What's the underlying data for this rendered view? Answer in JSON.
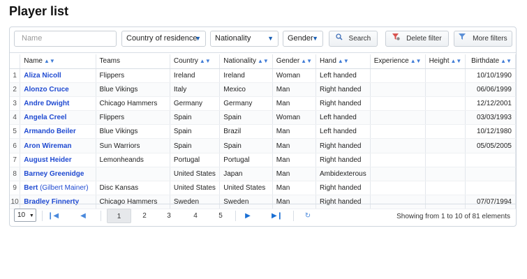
{
  "page_title": "Player list",
  "filters": {
    "name_placeholder": "Name",
    "country": "Country of residence",
    "nationality": "Nationality",
    "gender": "Gender",
    "search": "Search",
    "delete_filter": "Delete filter",
    "more_filters": "More filters"
  },
  "columns": [
    "Name",
    "Teams",
    "Country",
    "Nationality",
    "Gender",
    "Hand",
    "Experience",
    "Height",
    "Birthdate"
  ],
  "rows": [
    {
      "idx": "1",
      "name": "Aliza Nicoll",
      "alt": "",
      "teams": "Flippers",
      "country": "Ireland",
      "nationality": "Ireland",
      "gender": "Woman",
      "hand": "Left handed",
      "experience": "",
      "height": "",
      "birthdate": "10/10/1990"
    },
    {
      "idx": "2",
      "name": "Alonzo Cruce",
      "alt": "",
      "teams": "Blue Vikings",
      "country": "Italy",
      "nationality": "Mexico",
      "gender": "Man",
      "hand": "Right handed",
      "experience": "",
      "height": "",
      "birthdate": "06/06/1999"
    },
    {
      "idx": "3",
      "name": "Andre Dwight",
      "alt": "",
      "teams": "Chicago Hammers",
      "country": "Germany",
      "nationality": "Germany",
      "gender": "Man",
      "hand": "Right handed",
      "experience": "",
      "height": "",
      "birthdate": "12/12/2001"
    },
    {
      "idx": "4",
      "name": "Angela Creel",
      "alt": "",
      "teams": "Flippers",
      "country": "Spain",
      "nationality": "Spain",
      "gender": "Woman",
      "hand": "Left handed",
      "experience": "",
      "height": "",
      "birthdate": "03/03/1993"
    },
    {
      "idx": "5",
      "name": "Armando Beiler",
      "alt": "",
      "teams": "Blue Vikings",
      "country": "Spain",
      "nationality": "Brazil",
      "gender": "Man",
      "hand": "Left handed",
      "experience": "",
      "height": "",
      "birthdate": "10/12/1980"
    },
    {
      "idx": "6",
      "name": "Aron Wireman",
      "alt": "",
      "teams": "Sun Warriors",
      "country": "Spain",
      "nationality": "Spain",
      "gender": "Man",
      "hand": "Right handed",
      "experience": "",
      "height": "",
      "birthdate": "05/05/2005"
    },
    {
      "idx": "7",
      "name": "August Heider",
      "alt": "",
      "teams": "Lemonheands",
      "country": "Portugal",
      "nationality": "Portugal",
      "gender": "Man",
      "hand": "Right handed",
      "experience": "",
      "height": "",
      "birthdate": ""
    },
    {
      "idx": "8",
      "name": "Barney Greenidge",
      "alt": "",
      "teams": "",
      "country": "United States",
      "nationality": "Japan",
      "gender": "Man",
      "hand": "Ambidexterous",
      "experience": "",
      "height": "",
      "birthdate": ""
    },
    {
      "idx": "9",
      "name": "Bert",
      "alt": "(Gilbert Mainer)",
      "teams": "Disc Kansas",
      "country": "United States",
      "nationality": "United States",
      "gender": "Man",
      "hand": "Right handed",
      "experience": "",
      "height": "",
      "birthdate": ""
    },
    {
      "idx": "10",
      "name": "Bradley Finnerty",
      "alt": "",
      "teams": "Chicago Hammers",
      "country": "Sweden",
      "nationality": "Sweden",
      "gender": "Man",
      "hand": "Right handed",
      "experience": "",
      "height": "",
      "birthdate": "07/07/1994"
    }
  ],
  "pager": {
    "page_size": "10",
    "pages": [
      "1",
      "2",
      "3",
      "4",
      "5"
    ],
    "status": "Showing from 1 to 10 of 81 elements"
  },
  "icons": {
    "search": "magnifier-icon",
    "delete": "filter-delete-icon",
    "more": "more-filters-icon",
    "sort": "sort-icon",
    "first": "first-page-icon",
    "prev": "prev-page-icon",
    "next": "next-page-icon",
    "last": "last-page-icon",
    "refresh": "refresh-icon"
  },
  "colors": {
    "link": "#1f4ad1",
    "accent": "#4a89dc"
  }
}
